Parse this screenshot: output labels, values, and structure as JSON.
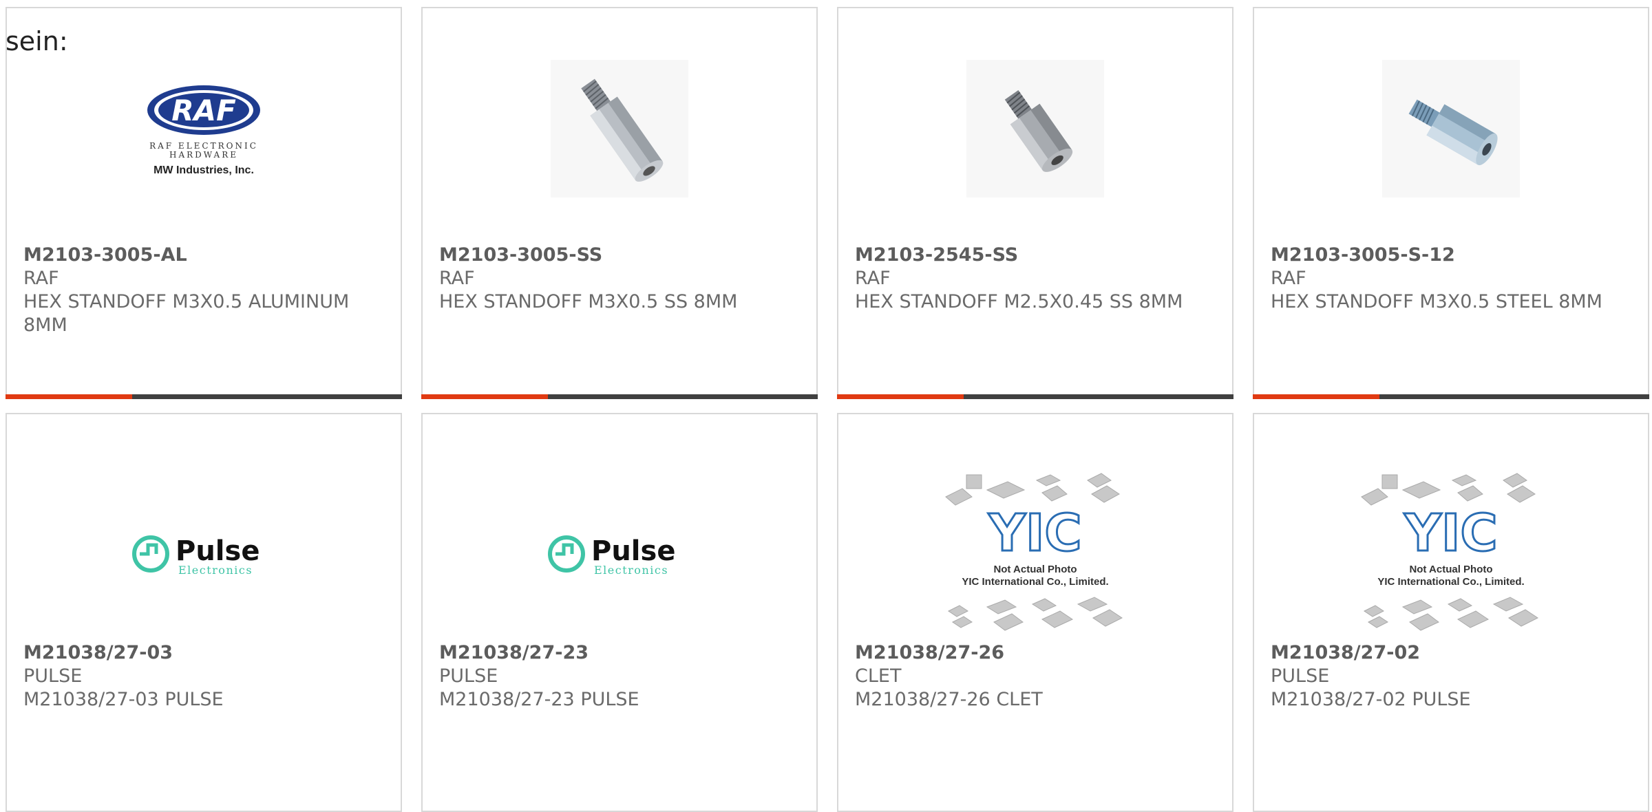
{
  "page": {
    "label": "sein:"
  },
  "colors": {
    "accent": "#e03a12",
    "bar": "#404040",
    "text": "#6a6a6a",
    "border": "#d8d8d8"
  },
  "products": [
    {
      "part_number": "M2103-3005-AL",
      "manufacturer": "RAF",
      "description": "HEX STANDOFF M3X0.5 ALUMINUM 8MM",
      "image": "raf-logo",
      "logo_text": "RAF",
      "logo_sub1": "RAF ELECTRONIC",
      "logo_sub2": "HARDWARE",
      "logo_sub3": "MW Industries, Inc."
    },
    {
      "part_number": "M2103-3005-SS",
      "manufacturer": "RAF",
      "description": "HEX STANDOFF M3X0.5 SS 8MM",
      "image": "hex-standoff-long"
    },
    {
      "part_number": "M2103-2545-SS",
      "manufacturer": "RAF",
      "description": "HEX STANDOFF M2.5X0.45 SS 8MM",
      "image": "hex-standoff-short"
    },
    {
      "part_number": "M2103-3005-S-12",
      "manufacturer": "RAF",
      "description": "HEX STANDOFF M3X0.5 STEEL 8MM",
      "image": "hex-standoff-blue"
    },
    {
      "part_number": "M21038/27-03",
      "manufacturer": "PULSE",
      "description": "M21038/27-03 PULSE",
      "image": "pulse-logo",
      "logo_text": "Pulse",
      "logo_sub1": "Electronics"
    },
    {
      "part_number": "M21038/27-23",
      "manufacturer": "PULSE",
      "description": "M21038/27-23 PULSE",
      "image": "pulse-logo",
      "logo_text": "Pulse",
      "logo_sub1": "Electronics"
    },
    {
      "part_number": "M21038/27-26",
      "manufacturer": "CLET",
      "description": "M21038/27-26 CLET",
      "image": "yic-placeholder",
      "logo_text": "YIC",
      "logo_sub1": "Not Actual Photo",
      "logo_sub2": "YIC International Co., Limited."
    },
    {
      "part_number": "M21038/27-02",
      "manufacturer": "PULSE",
      "description": "M21038/27-02 PULSE",
      "image": "yic-placeholder",
      "logo_text": "YIC",
      "logo_sub1": "Not Actual Photo",
      "logo_sub2": "YIC International Co., Limited."
    }
  ]
}
